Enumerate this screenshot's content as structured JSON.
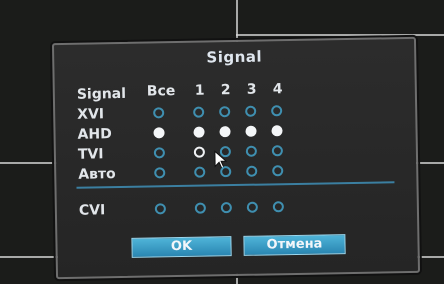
{
  "dialog": {
    "title": "Signal",
    "header": {
      "signal": "Signal",
      "all": "Все",
      "channels": [
        "1",
        "2",
        "3",
        "4"
      ]
    },
    "rows": [
      {
        "label": "XVI",
        "all": false,
        "ch": [
          false,
          false,
          false,
          false
        ]
      },
      {
        "label": "AHD",
        "all": true,
        "ch": [
          true,
          true,
          true,
          true
        ]
      },
      {
        "label": "TVI",
        "all": false,
        "ch": [
          false,
          false,
          false,
          false
        ]
      },
      {
        "label": "Авто",
        "all": false,
        "ch": [
          false,
          false,
          false,
          false
        ]
      },
      {
        "label": "CVI",
        "all": false,
        "ch": [
          false,
          false,
          false,
          false
        ]
      }
    ],
    "ok_label": "OK",
    "cancel_label": "Отмена"
  },
  "colors": {
    "accent": "#2a86b2",
    "radio_border": "#3f8fb0",
    "background": "#1b1c1a"
  }
}
